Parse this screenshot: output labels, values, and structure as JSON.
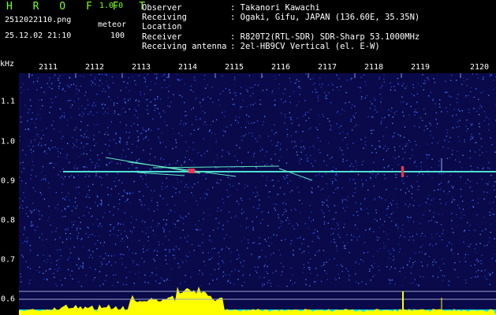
{
  "header": {
    "logo": "H R O F F T",
    "version": "1.0.0",
    "filename": "2512022110.png",
    "mode": "meteor",
    "datetime": "25.12.02 21:10",
    "count": "100"
  },
  "info": [
    {
      "label": "Observer",
      "value": ": Takanori Kawachi"
    },
    {
      "label": "Receiving Location",
      "value": ": Ogaki, Gifu, JAPAN (136.60E, 35.35N)"
    },
    {
      "label": "Receiver",
      "value": ": R820T2(RTL-SDR) SDR-Sharp 53.1000MHz"
    },
    {
      "label": "Receiving antenna",
      "value": ": 2el-HB9CV Vertical (el. E-W)"
    }
  ],
  "axis": {
    "y_unit": "kHz",
    "x_ticks": [
      "2111",
      "2112",
      "2113",
      "2114",
      "2115",
      "2116",
      "2117",
      "2118",
      "2119",
      "2120"
    ],
    "y_ticks": [
      "1.1",
      "1.0",
      "0.9",
      "0.8",
      "0.7",
      "0.6"
    ]
  },
  "colors": {
    "background": "#0a0a4a",
    "noise": "#2a5cff",
    "carrier": "#4fe0d0",
    "spectrum_fill": "#ffff00",
    "spectrum_base": "#00e5ff",
    "logo": "#7CFF2A"
  }
}
